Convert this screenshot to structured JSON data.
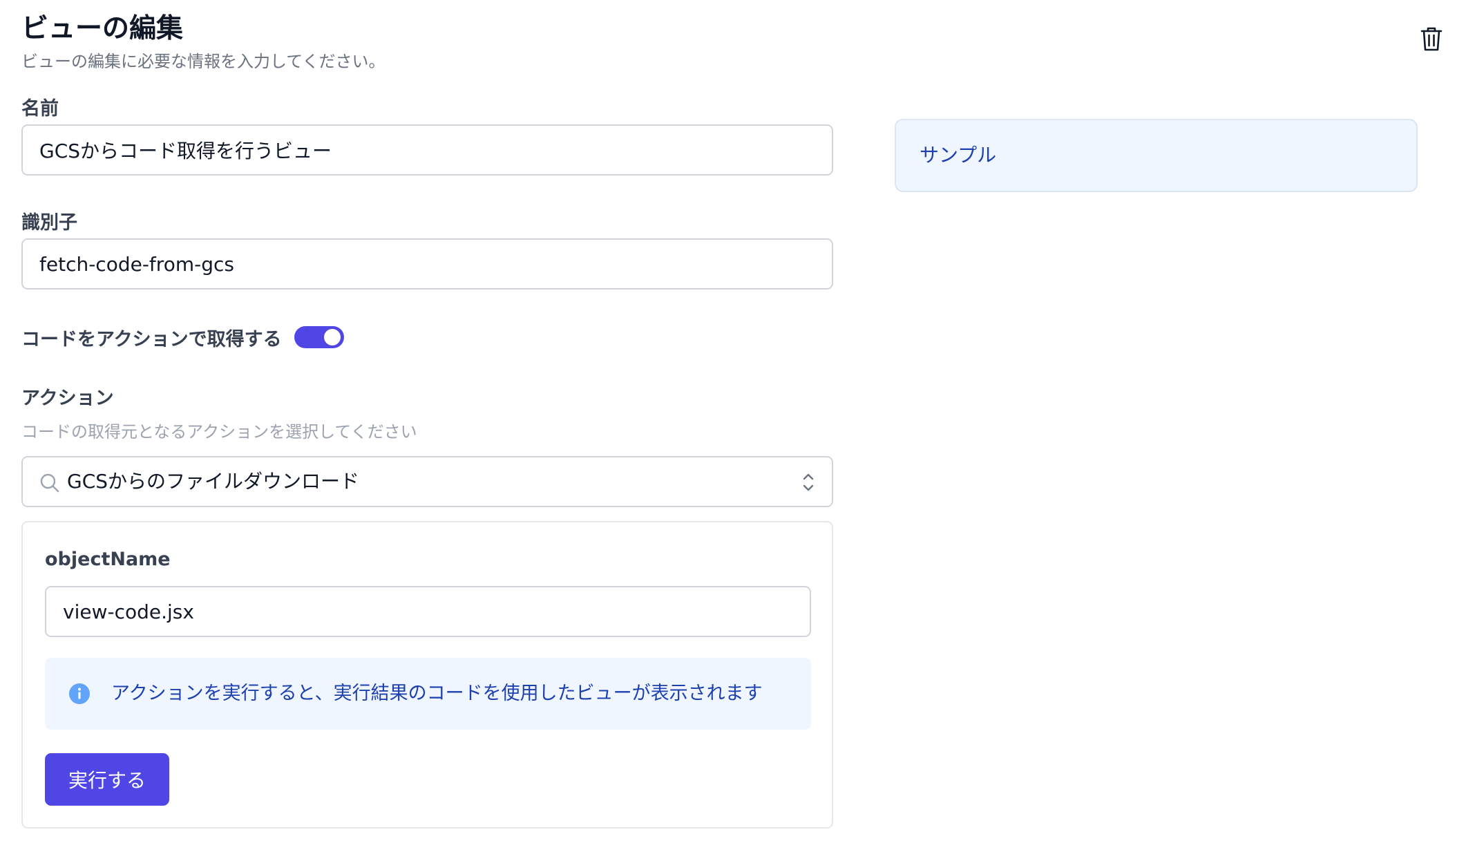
{
  "header": {
    "title": "ビューの編集",
    "subtitle": "ビューの編集に必要な情報を入力してください。"
  },
  "icons": {
    "delete": "trash-icon",
    "search": "search-icon",
    "select": "chevron-up-down-icon",
    "info": "info-circle-icon"
  },
  "form": {
    "name": {
      "label": "名前",
      "value": "GCSからコード取得を行うビュー"
    },
    "identifier": {
      "label": "識別子",
      "value": "fetch-code-from-gcs"
    },
    "fetch_by_action": {
      "label": "コードをアクションで取得する",
      "enabled": true
    },
    "action": {
      "label": "アクション",
      "helper": "コードの取得元となるアクションを選択してください",
      "selected": "GCSからのファイルダウンロード"
    },
    "params": {
      "object_name": {
        "label": "objectName",
        "value": "view-code.jsx"
      },
      "info": "アクションを実行すると、実行結果のコードを使用したビューが表示されます",
      "run_label": "実行する"
    }
  },
  "preview": {
    "sample_label": "サンプル"
  },
  "colors": {
    "accent": "#4f46e5",
    "info_bg": "#eff6ff",
    "info_text": "#1e40af"
  }
}
